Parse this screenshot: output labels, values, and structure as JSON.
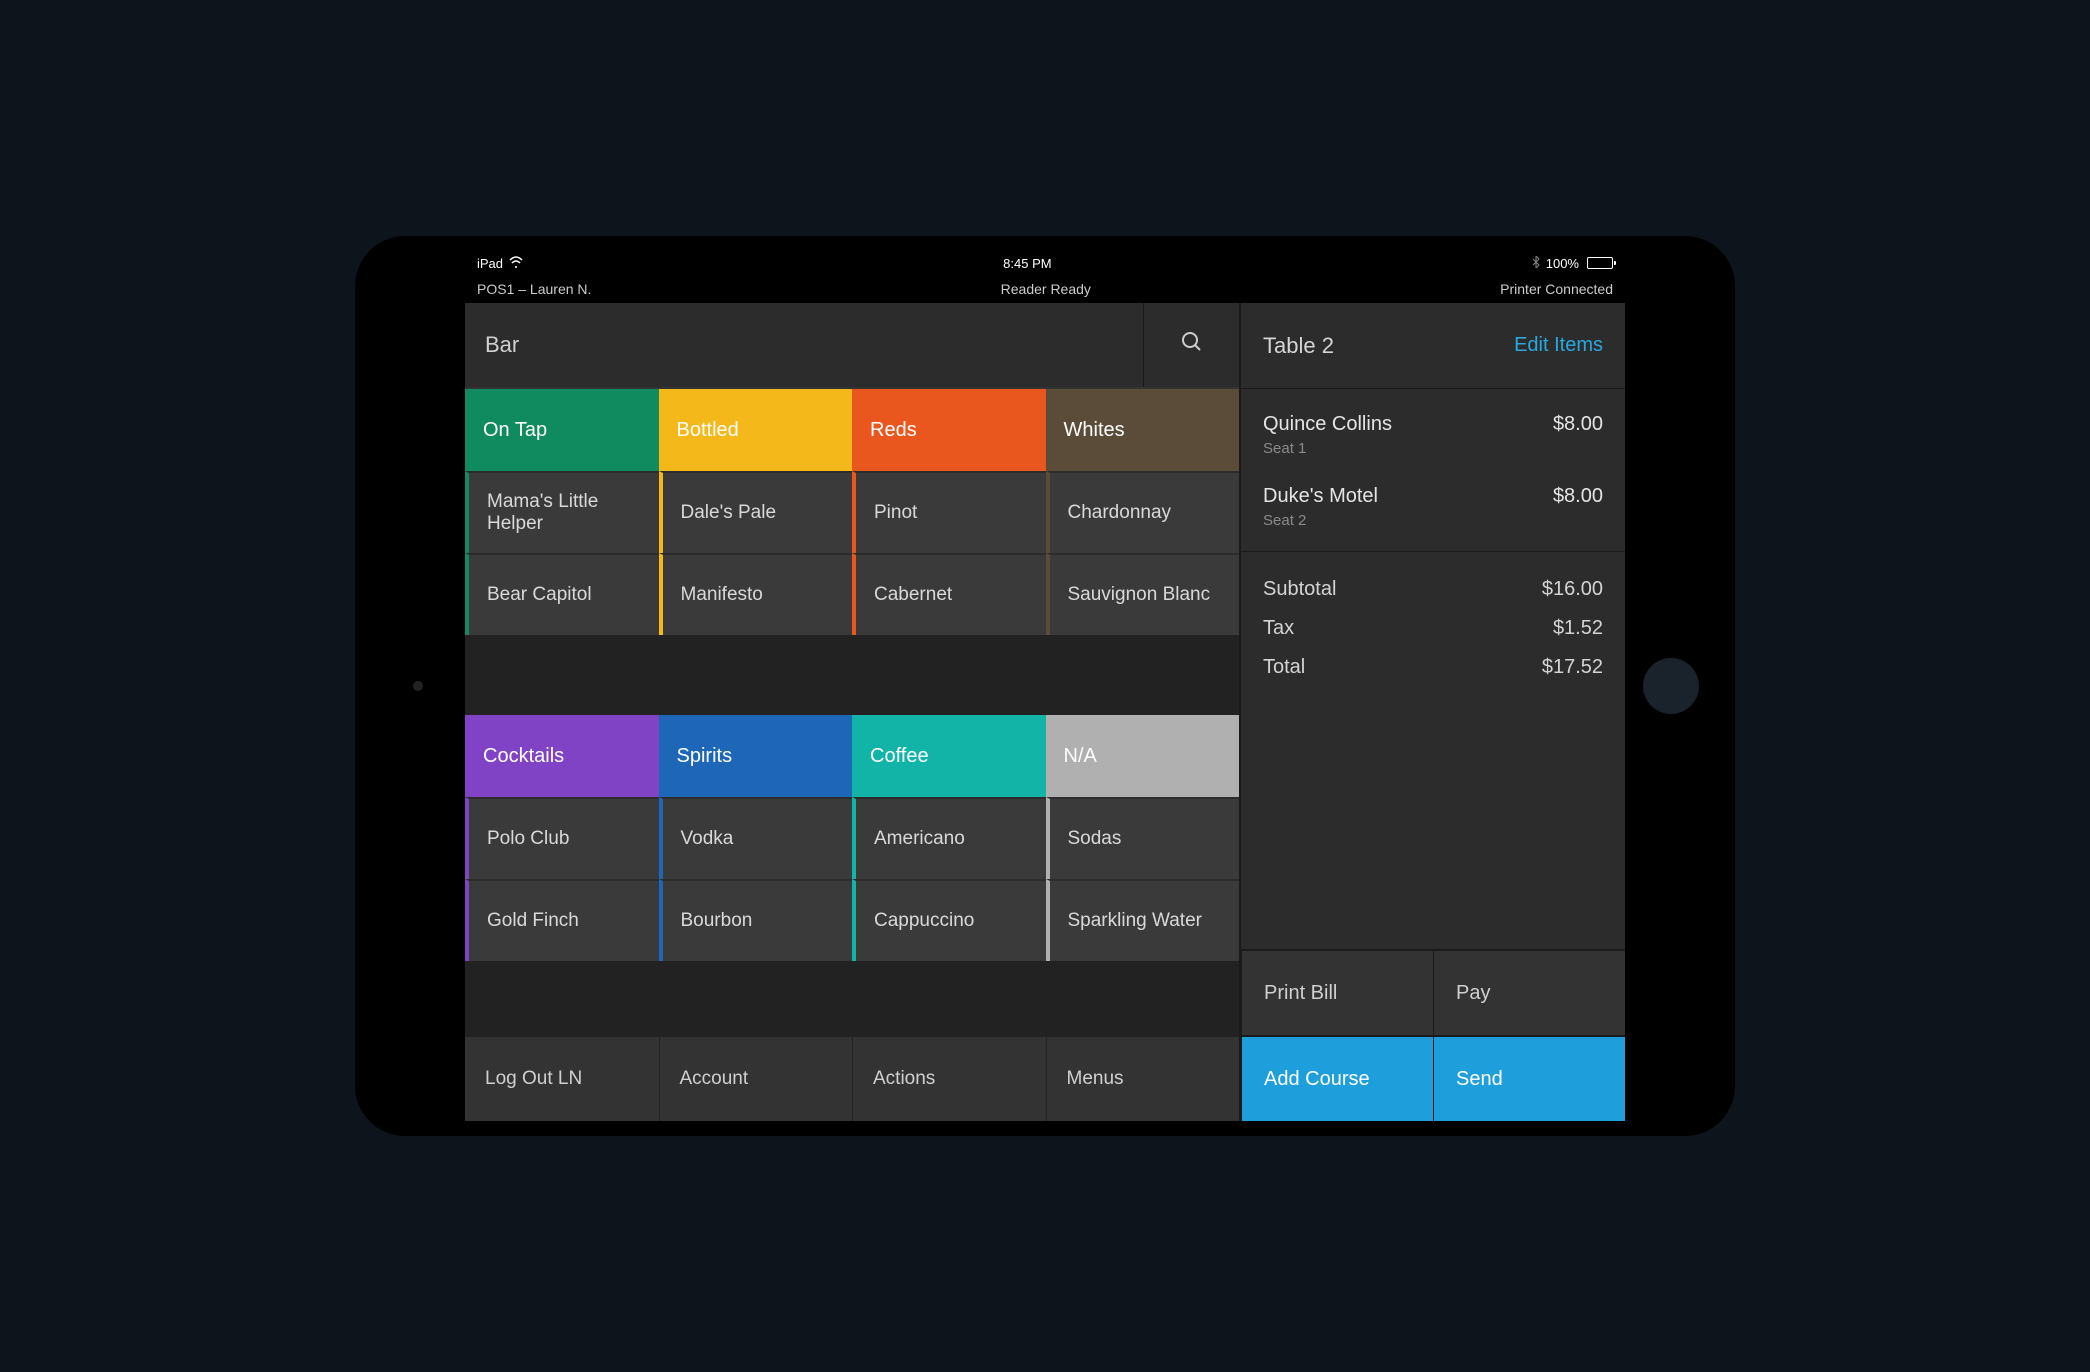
{
  "status": {
    "device": "iPad",
    "time": "8:45 PM",
    "battery_pct": "100%"
  },
  "substatus": {
    "left": "POS1 – Lauren N.",
    "center": "Reader Ready",
    "right": "Printer Connected"
  },
  "menu": {
    "title": "Bar",
    "groups": [
      [
        {
          "name": "On Tap",
          "color": "#0f8b5f",
          "items": [
            "Mama's Little Helper",
            "Bear Capitol"
          ]
        },
        {
          "name": "Bottled",
          "color": "#f4b81b",
          "items": [
            "Dale's Pale",
            "Manifesto"
          ]
        },
        {
          "name": "Reds",
          "color": "#e9571e",
          "items": [
            "Pinot",
            "Cabernet"
          ]
        },
        {
          "name": "Whites",
          "color": "#5a4c38",
          "items": [
            "Chardonnay",
            "Sauvignon Blanc"
          ]
        }
      ],
      [
        {
          "name": "Cocktails",
          "color": "#8143c6",
          "items": [
            "Polo Club",
            "Gold Finch"
          ]
        },
        {
          "name": "Spirits",
          "color": "#1e66b8",
          "items": [
            "Vodka",
            "Bourbon"
          ]
        },
        {
          "name": "Coffee",
          "color": "#12b4a7",
          "items": [
            "Americano",
            "Cappuccino"
          ]
        },
        {
          "name": "N/A",
          "color": "#b0b0b0",
          "items": [
            "Sodas",
            "Sparkling Water"
          ]
        }
      ]
    ]
  },
  "controls": {
    "logout": "Log Out LN",
    "account": "Account",
    "actions": "Actions",
    "menus": "Menus"
  },
  "ticket": {
    "title": "Table 2",
    "edit": "Edit Items",
    "items": [
      {
        "name": "Quince Collins",
        "seat": "Seat 1",
        "price": "$8.00"
      },
      {
        "name": "Duke's Motel",
        "seat": "Seat 2",
        "price": "$8.00"
      }
    ],
    "totals": {
      "subtotal_label": "Subtotal",
      "subtotal": "$16.00",
      "tax_label": "Tax",
      "tax": "$1.52",
      "total_label": "Total",
      "total": "$17.52"
    },
    "actions": {
      "print": "Print Bill",
      "pay": "Pay",
      "add_course": "Add Course",
      "send": "Send"
    }
  }
}
